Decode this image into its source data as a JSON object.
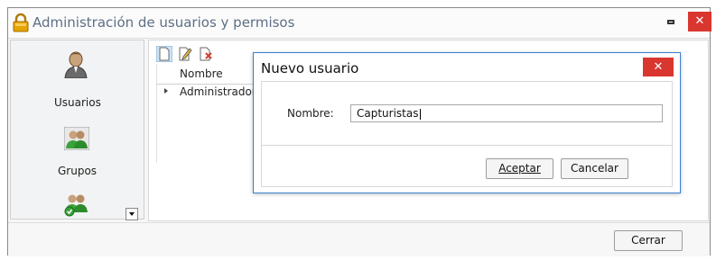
{
  "window": {
    "title": "Administración de usuarios y permisos",
    "close_glyph": "✕"
  },
  "sidebar": {
    "items": [
      {
        "label": "Usuarios",
        "icon": "user-icon"
      },
      {
        "label": "Grupos",
        "icon": "group-icon"
      },
      {
        "label": "",
        "icon": "group-permissions-icon"
      }
    ]
  },
  "toolbar": {
    "buttons": [
      "new-document-icon",
      "edit-document-icon",
      "delete-document-icon"
    ]
  },
  "grid": {
    "columns": [
      "Nombre"
    ],
    "rows": [
      "Administradores"
    ]
  },
  "footer": {
    "close_label": "Cerrar"
  },
  "dialog": {
    "title": "Nuevo usuario",
    "close_glyph": "✕",
    "field_label": "Nombre:",
    "field_value": "Capturistas",
    "accept_label": "Aceptar",
    "cancel_label": "Cancelar"
  },
  "colors": {
    "close_red": "#d9362f",
    "dialog_border": "#3c7dd0",
    "title_text": "#5d6f84"
  }
}
